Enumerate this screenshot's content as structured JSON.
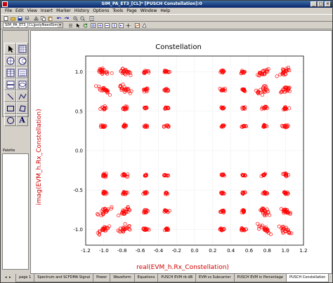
{
  "window": {
    "title": "SIM_PA_ET3_[CL]* [PUSCH Constellation]:0",
    "controls": [
      "_",
      "□",
      "×"
    ]
  },
  "menu": [
    "File",
    "Edit",
    "View",
    "Insert",
    "Marker",
    "History",
    "Options",
    "Tools",
    "Page",
    "Window",
    "Help"
  ],
  "toolbar2": {
    "dataset_select": "SIM_PA_ET3_[CL]polyNeedSim"
  },
  "palette": {
    "title": "Palette"
  },
  "tabs": {
    "labels": [
      "page 1",
      "Spectrum and SCFDMA Signal",
      "Power",
      "Waveform",
      "Equations",
      "PUSCH EVM rb dB",
      "EVM vs Subcarrier",
      "PUSCH EVM in Percentage",
      "PUSCH Constellation"
    ],
    "active_index": 8
  },
  "chart_data": {
    "type": "scatter",
    "title": "Constellation",
    "xlabel": "real(EVM_h.Rx_Constellation)",
    "ylabel": "imag(EVM_h.Rx_Constellation)",
    "xlim": [
      -1.2,
      1.2
    ],
    "ylim": [
      -1.2,
      1.2
    ],
    "x_ticks": [
      "-1.2",
      "-1.0",
      "-0.8",
      "-0.6",
      "-0.4",
      "-0.2",
      "0.0",
      "0.2",
      "0.4",
      "0.6",
      "0.8",
      "1.0",
      "1.2"
    ],
    "y_ticks": [
      "1.0",
      "0.5",
      "0.0",
      "-0.5",
      "-1.0"
    ],
    "x_tick_values": [
      -1.2,
      -1.0,
      -0.8,
      -0.6,
      -0.4,
      -0.2,
      0.0,
      0.2,
      0.4,
      0.6,
      0.8,
      1.0,
      1.2
    ],
    "y_tick_values": [
      1.0,
      0.5,
      0.0,
      -0.5,
      -1.0
    ],
    "grid": true,
    "marker": "circle",
    "color": "#ff0000",
    "ideal_levels": [
      -1.0,
      -0.77,
      -0.54,
      -0.31,
      0.31,
      0.54,
      0.77,
      1.0
    ],
    "outer_scatter_levels": [
      -1.0,
      -0.77,
      0.77,
      1.0
    ],
    "corner_smear_levels": [
      -1.0,
      -0.77,
      0.77,
      1.0
    ]
  }
}
